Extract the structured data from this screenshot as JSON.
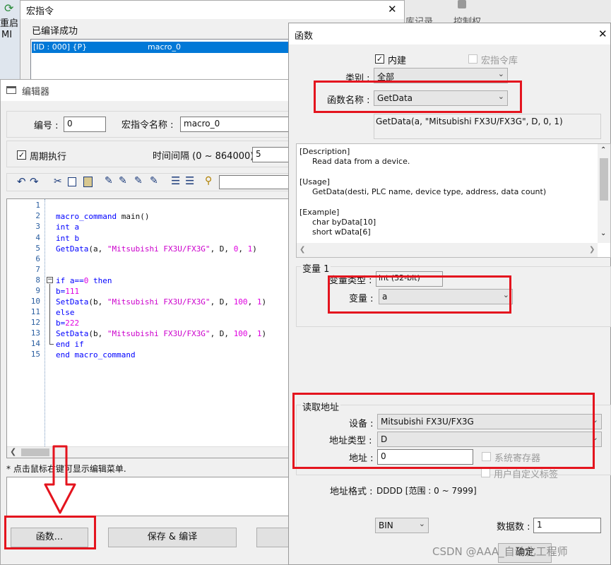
{
  "bg_hmi": {
    "left_label_1": "重启",
    "left_label_2": "MI",
    "right_label_1": "库记录",
    "right_label_2": "控制权"
  },
  "macro_window": {
    "title": "宏指令",
    "status": "已编译成功",
    "list_row_id": "[ID : 000] {P}",
    "list_row_name": "macro_0",
    "close_glyph": "✕"
  },
  "editor": {
    "title": "编辑器",
    "number_label": "编号 :",
    "number_value": "0",
    "macro_name_label": "宏指令名称 :",
    "macro_name_value": "macro_0",
    "periodic_label": "周期执行",
    "periodic_checked": "✓",
    "interval_label": "时间间隔 (0 ~ 864000) :",
    "interval_value": "5",
    "hint": "* 点击鼠标右键可显示编辑菜单.",
    "function_button": "函数...",
    "save_compile_button": "保存 & 编译",
    "line_numbers": [
      "1",
      "2",
      "3",
      "4",
      "5",
      "6",
      "7",
      "8",
      "9",
      "10",
      "11",
      "12",
      "13",
      "14",
      "15"
    ],
    "code": {
      "l2_kw": "macro_command",
      "l2_rest": " main()",
      "l3_kw": "int",
      "l3_rest": " a",
      "l4_kw": "int",
      "l4_rest": " b",
      "l5_fn": "GetData",
      "l5_a": "(a, ",
      "l5_str": "\"Mitsubishi FX3U/FX3G\"",
      "l5_b": ", D, ",
      "l5_n1": "0",
      "l5_c": ", ",
      "l5_n2": "1",
      "l5_d": ")",
      "l8_kw": "if",
      "l8_a": " a==",
      "l8_n": "0",
      "l8_kw2": " then",
      "l9_a": "b=",
      "l9_n": "111",
      "l10_fn": "SetData",
      "l10_a": "(b, ",
      "l10_str": "\"Mitsubishi FX3U/FX3G\"",
      "l10_b": ", D, ",
      "l10_n1": "100",
      "l10_c": ", ",
      "l10_n2": "1",
      "l10_d": ")",
      "l11_kw": "else",
      "l12_a": "b=",
      "l12_n": "222",
      "l13_fn": "SetData",
      "l13_a": "(b, ",
      "l13_str": "\"Mitsubishi FX3U/FX3G\"",
      "l13_b": ", D, ",
      "l13_n1": "100",
      "l13_c": ", ",
      "l13_n2": "1",
      "l13_d": ")",
      "l14_kw": "end if",
      "l15_kw": "end macro_command"
    }
  },
  "function_dialog": {
    "title": "函数",
    "close_glyph": "✕",
    "builtin_label": "内建",
    "builtin_checked": "✓",
    "macro_lib_label": "宏指令库",
    "category_label": "类别 :",
    "category_value": "全部",
    "func_name_label": "函数名称 :",
    "func_name_value": "GetData",
    "signature": "GetData(a, \"Mitsubishi FX3U/FX3G\", D, 0, 1)",
    "description": {
      "h1": "[Description]",
      "t1": "Read data from a device.",
      "h2": "[Usage]",
      "t2": "GetData(desti, PLC name, device type, address, data count)",
      "h3": "[Example]",
      "t3": "char byData[10]",
      "t4": "short wData[6]"
    },
    "var_group": "变量 1",
    "var_type_label": "变量类型 :",
    "var_type_value": "int (32-bit)",
    "var_label": "变量 :",
    "var_value": "a",
    "read_group": "读取地址",
    "device_label": "设备 :",
    "device_value": "Mitsubishi FX3U/FX3G",
    "addr_type_label": "地址类型 :",
    "addr_type_value": "D",
    "addr_label": "地址 :",
    "addr_value": "0",
    "sys_reg_label": "系统寄存器",
    "user_tag_label": "用户自定义标签",
    "addr_format_label": "地址格式 :",
    "addr_format_value": "DDDD [范围 : 0 ~ 7999]",
    "format_value": "BIN",
    "count_label": "数据数 :",
    "count_value": "1",
    "ok_button": "确定"
  },
  "watermark": "CSDN @AAA_自动化工程师",
  "colors": {
    "highlight": "#e4141e",
    "keyword": "#0000ff",
    "string": "#cc00cc",
    "number": "#e000e0",
    "selection": "#0078d7"
  }
}
